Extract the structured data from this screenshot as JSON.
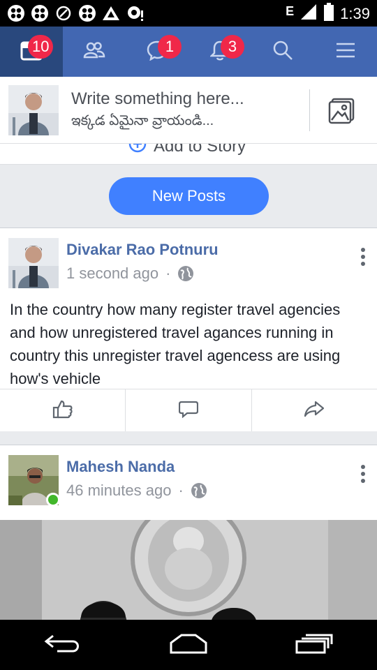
{
  "status_bar": {
    "network": "E",
    "time": "1:39",
    "icons": [
      "grid-app-icon",
      "grid-app-icon",
      "speedometer-icon",
      "grid-app-icon",
      "warning-icon",
      "chat-notification-icon",
      "signal-icon",
      "battery-icon"
    ]
  },
  "nav": {
    "items": [
      {
        "name": "news-feed-icon",
        "badge": "10"
      },
      {
        "name": "friends-icon",
        "badge": ""
      },
      {
        "name": "messages-icon",
        "badge": "1"
      },
      {
        "name": "notifications-icon",
        "badge": "3"
      },
      {
        "name": "search-icon",
        "badge": ""
      },
      {
        "name": "menu-icon",
        "badge": ""
      }
    ]
  },
  "composer": {
    "placeholder_en": "Write something here...",
    "placeholder_te": "ఇక్కడ ఏమైనా వ్రాయండి..."
  },
  "story": {
    "label": "Add to Story"
  },
  "new_posts_label": "New Posts",
  "posts": [
    {
      "author": "Divakar Rao Potnuru",
      "time": "1 second ago",
      "separator": "·",
      "text": "In the country how many register travel agencies and how unregistered travel agances running in country this unregister travel agencess are using how's vehicle"
    },
    {
      "author": "Mahesh Nanda",
      "time": "46 minutes ago",
      "separator": "·",
      "online": true
    }
  ],
  "colors": {
    "brand": "#4267b2",
    "brand_dark": "#29487d",
    "badge": "#f02849",
    "new_posts": "#4080ff",
    "author": "#4b6ca8",
    "online": "#42b72a"
  }
}
